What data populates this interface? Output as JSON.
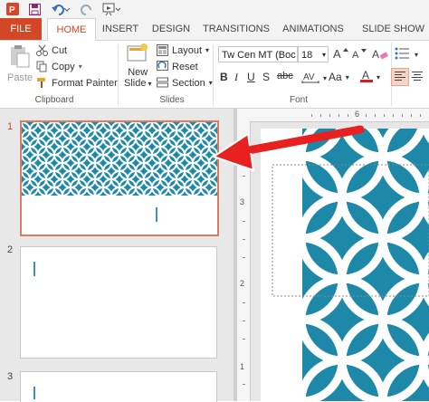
{
  "ribbon": {
    "tabs": [
      "FILE",
      "HOME",
      "INSERT",
      "DESIGN",
      "TRANSITIONS",
      "ANIMATIONS",
      "SLIDE SHOW"
    ],
    "clipboard": {
      "paste": "Paste",
      "cut": "Cut",
      "copy": "Copy",
      "format_painter": "Format Painter",
      "label": "Clipboard"
    },
    "slides": {
      "new_slide_line1": "New",
      "new_slide_line2": "Slide",
      "layout": "Layout",
      "reset": "Reset",
      "section": "Section",
      "label": "Slides"
    },
    "font": {
      "font_name": "Tw Cen MT (Boc",
      "font_size": "18",
      "label": "Font"
    }
  },
  "thumbnails": [
    {
      "number": "1"
    },
    {
      "number": "2"
    },
    {
      "number": "3"
    }
  ],
  "ruler": {
    "top_mark": "6",
    "left_marks": [
      "3",
      "2",
      "1"
    ]
  },
  "colors": {
    "accent": "#d24726",
    "slide_teal": "#1e88a8",
    "selection_border": "#e07a5f",
    "arrow_red": "#e8201f"
  }
}
